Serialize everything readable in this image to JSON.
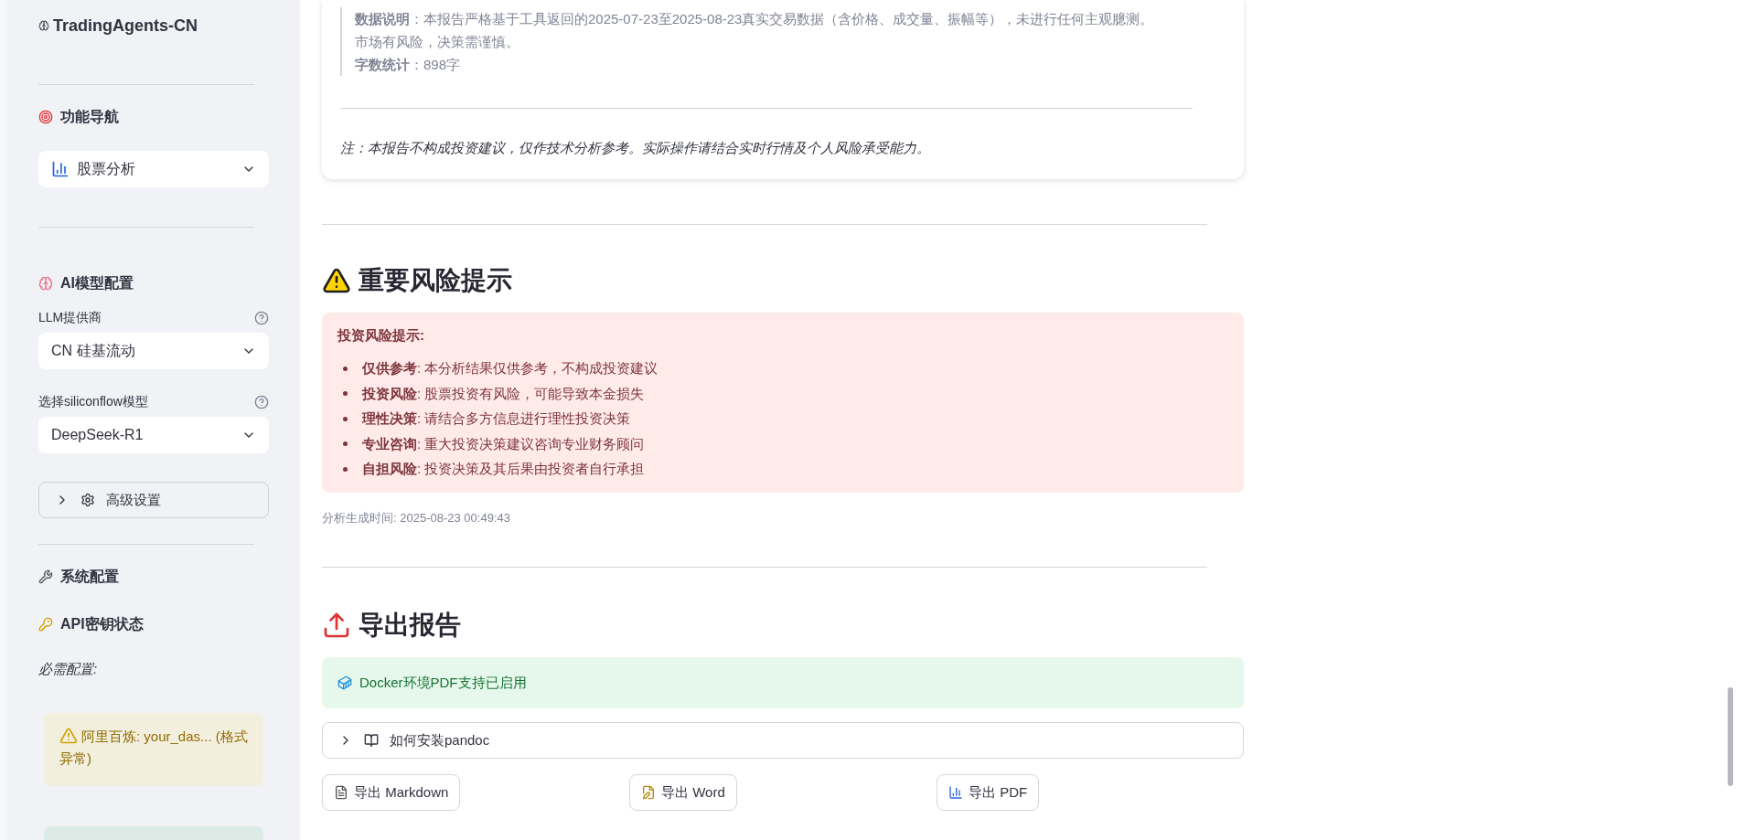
{
  "sidebar": {
    "title": "TradingAgents-CN",
    "nav": {
      "heading": "功能导航",
      "select": {
        "value": "股票分析"
      }
    },
    "model": {
      "heading": "AI模型配置",
      "fields": [
        {
          "label": "LLM提供商",
          "value": "CN 硅基流动"
        },
        {
          "label": "选择siliconflow模型",
          "value": "DeepSeek-R1"
        }
      ],
      "advanced": {
        "label": "高级设置",
        "expanded": false
      }
    },
    "system_heading": "系统配置",
    "api_heading": "API密钥状态",
    "required_label": "必需配置:",
    "alerts": [
      {
        "kind": "warning",
        "text": "阿里百炼: your_das... (格式异常)"
      },
      {
        "kind": "success"
      }
    ]
  },
  "report": {
    "lines": [
      "**数据说明**：本报告严格基于工具返回的2025-07-23至2025-08-23真实交易数据（含价格、成交量、振幅等），未进行任何主观臆测。",
      "市场有风险，决策需谨慎。",
      "**字数统计**：898字"
    ],
    "note": "注：本报告不构成投资建议，仅作技术分析参考。实际操作请结合实时行情及个人风险承受能力。"
  },
  "risk": {
    "heading": "重要风险提示",
    "title": "投资风险提示:",
    "items": [
      "**仅供参考**: 本分析结果仅供参考，不构成投资建议",
      "**投资风险**: 股票投资有风险，可能导致本金损失",
      "**理性决策**: 请结合多方信息进行理性投资决策",
      "**专业咨询**: 重大投资决策建议咨询专业财务顾问",
      "**自担风险**: 投资决策及其后果由投资者自行承担"
    ],
    "timestamp": "分析生成时间: 2025-08-23 00:49:43"
  },
  "export": {
    "heading": "导出报告",
    "status": "Docker环境PDF支持已启用",
    "pandoc": {
      "label": "如何安装pandoc",
      "expanded": false
    },
    "buttons": [
      {
        "kind": "markdown",
        "label": "导出 Markdown"
      },
      {
        "kind": "word",
        "label": "导出 Word"
      },
      {
        "kind": "pdf",
        "label": "导出 PDF"
      }
    ]
  }
}
